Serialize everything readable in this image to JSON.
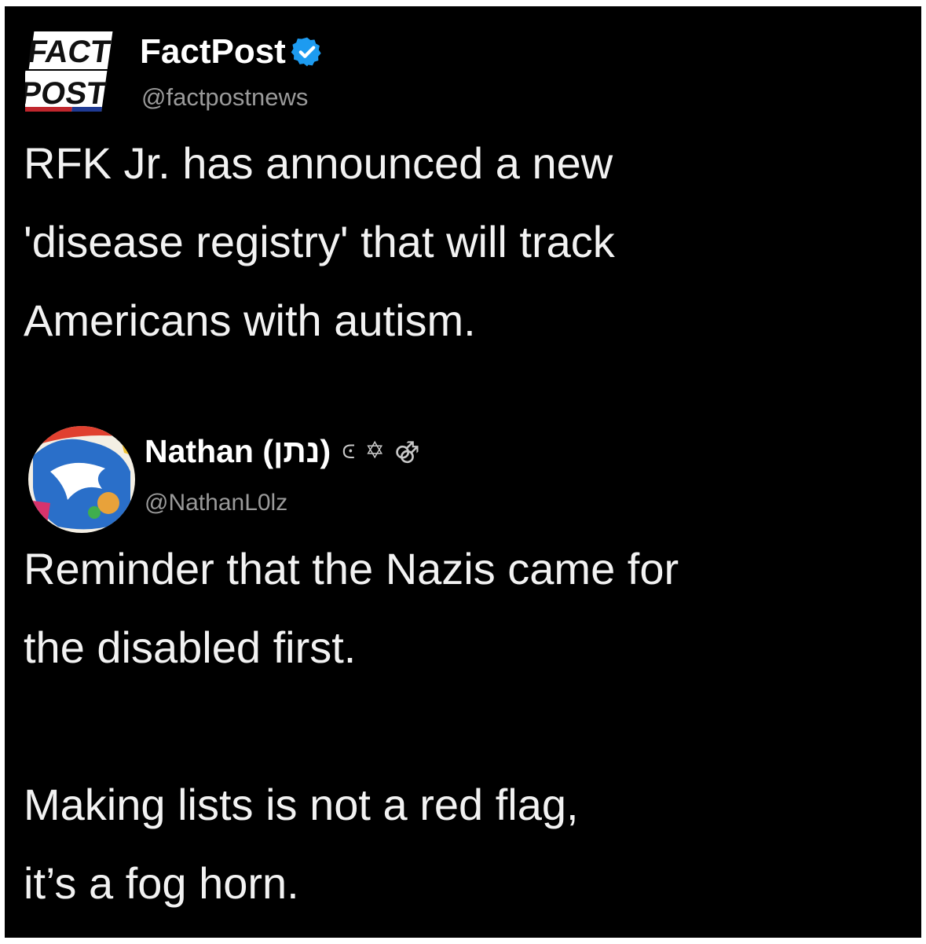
{
  "tweet1": {
    "display_name": "FactPost",
    "handle": "@factpostnews",
    "avatar_line1": "FACT",
    "avatar_line2": "POST",
    "verified_color": "#1d9bf0",
    "text": "RFK Jr. has announced a new\n'disease registry' that will track\nAmericans with autism."
  },
  "tweet2": {
    "display_name": "Nathan (נתן)",
    "handle": "@NathanL0lz",
    "emojis": [
      "⪽",
      "✡",
      "⚣"
    ],
    "text": "Reminder that the Nazis came for\nthe disabled first.\n\nMaking lists is not a red flag,\nit’s a fog horn."
  }
}
